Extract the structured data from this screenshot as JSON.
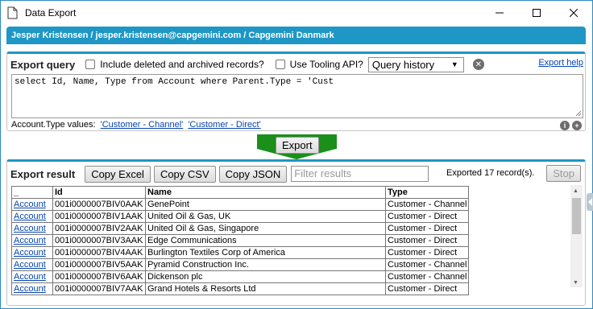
{
  "window": {
    "title": "Data Export"
  },
  "user_bar": {
    "text": "Jesper Kristensen / jesper.kristensen@capgemini.com / Capgemini Danmark"
  },
  "query_panel": {
    "heading": "Export query",
    "include_deleted_label": "Include deleted and archived records?",
    "include_deleted_checked": false,
    "tooling_api_label": "Use Tooling API?",
    "tooling_api_checked": false,
    "history_select_value": "Query history",
    "export_help_link": "Export help",
    "query_text": "select Id, Name, Type from Account where Parent.Type = 'Cust",
    "type_values_label": "Account.Type values:",
    "type_value_1": "'Customer - Channel'",
    "type_value_2": "'Customer - Direct'"
  },
  "export_button_label": "Export",
  "result_panel": {
    "heading": "Export result",
    "copy_excel": "Copy Excel",
    "copy_csv": "Copy CSV",
    "copy_json": "Copy JSON",
    "filter_placeholder": "Filter results",
    "exported_status": "Exported 17 record(s).",
    "stop_label": "Stop"
  },
  "table": {
    "columns": [
      "_",
      "Id",
      "Name",
      "Type"
    ],
    "rows": [
      {
        "obj": "Account",
        "id": "001i0000007BIV0AAK",
        "name": "GenePoint",
        "type": "Customer - Channel"
      },
      {
        "obj": "Account",
        "id": "001i0000007BIV1AAK",
        "name": "United Oil & Gas, UK",
        "type": "Customer - Direct"
      },
      {
        "obj": "Account",
        "id": "001i0000007BIV2AAK",
        "name": "United Oil & Gas, Singapore",
        "type": "Customer - Direct"
      },
      {
        "obj": "Account",
        "id": "001i0000007BIV3AAK",
        "name": "Edge Communications",
        "type": "Customer - Direct"
      },
      {
        "obj": "Account",
        "id": "001i0000007BIV4AAK",
        "name": "Burlington Textiles Corp of America",
        "type": "Customer - Direct"
      },
      {
        "obj": "Account",
        "id": "001i0000007BIV5AAK",
        "name": "Pyramid Construction Inc.",
        "type": "Customer - Channel"
      },
      {
        "obj": "Account",
        "id": "001i0000007BIV6AAK",
        "name": "Dickenson plc",
        "type": "Customer - Channel"
      },
      {
        "obj": "Account",
        "id": "001i0000007BIV7AAK",
        "name": "Grand Hotels & Resorts Ltd",
        "type": "Customer - Direct"
      }
    ]
  },
  "colors": {
    "accent": "#1e97c6",
    "export_arrow": "#1a8f1a",
    "link": "#0645ad"
  }
}
